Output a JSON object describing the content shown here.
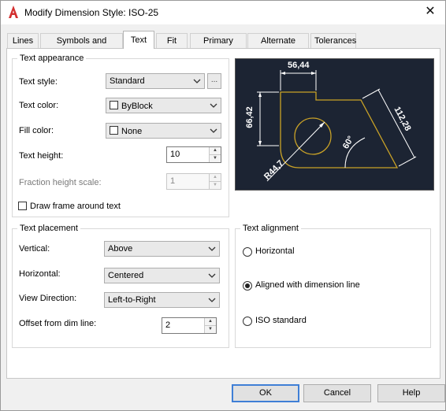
{
  "window": {
    "title": "Modify Dimension Style: ISO-25",
    "close_glyph": "✕"
  },
  "tabs": [
    {
      "label": "Lines"
    },
    {
      "label": "Symbols and Arrows"
    },
    {
      "label": "Text",
      "active": true
    },
    {
      "label": "Fit"
    },
    {
      "label": "Primary Units"
    },
    {
      "label": "Alternate Units"
    },
    {
      "label": "Tolerances"
    }
  ],
  "text_appearance": {
    "title": "Text appearance",
    "text_style_label": "Text style:",
    "text_style_value": "Standard",
    "browse_label": "...",
    "text_color_label": "Text color:",
    "text_color_value": "ByBlock",
    "fill_color_label": "Fill color:",
    "fill_color_value": "None",
    "text_height_label": "Text height:",
    "text_height_value": "10",
    "fraction_label": "Fraction height scale:",
    "fraction_value": "1",
    "draw_frame_label": "Draw frame around text",
    "draw_frame_checked": false
  },
  "preview": {
    "dim_top": "56,44",
    "dim_left": "66,42",
    "dim_right": "112,28",
    "dim_angle": "60°",
    "dim_radius": "R44,7",
    "colors": {
      "background": "#1c2433",
      "geometry": "#c9a227",
      "dims": "#ffffff"
    }
  },
  "text_placement": {
    "title": "Text placement",
    "vertical_label": "Vertical:",
    "vertical_value": "Above",
    "horizontal_label": "Horizontal:",
    "horizontal_value": "Centered",
    "view_direction_label": "View Direction:",
    "view_direction_value": "Left-to-Right",
    "offset_label": "Offset from dim line:",
    "offset_value": "2"
  },
  "text_alignment": {
    "title": "Text alignment",
    "options": [
      {
        "label": "Horizontal",
        "selected": false
      },
      {
        "label": "Aligned with dimension line",
        "selected": true
      },
      {
        "label": "ISO standard",
        "selected": false
      }
    ]
  },
  "buttons": {
    "ok": "OK",
    "cancel": "Cancel",
    "help": "Help"
  },
  "colors": {
    "accent": "#3f7fd6",
    "logo": "#d32f2f"
  }
}
